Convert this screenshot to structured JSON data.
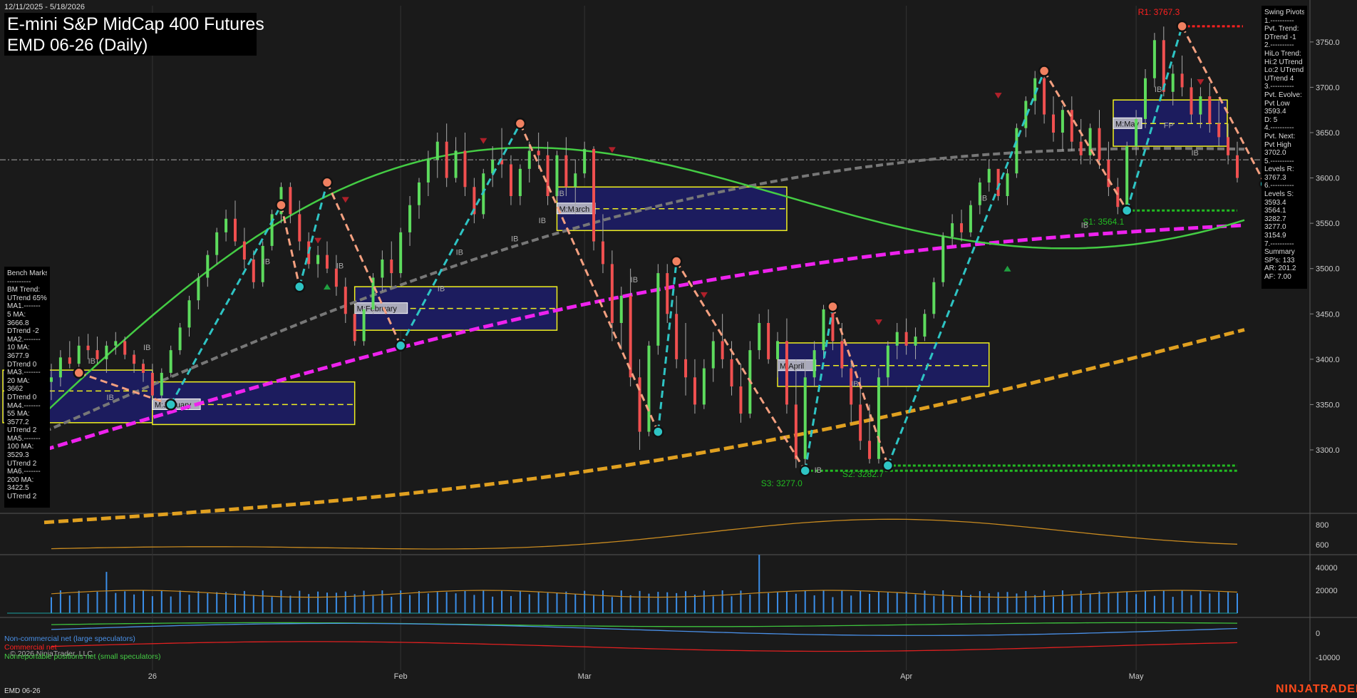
{
  "header": {
    "date_range": "12/11/2025 - 5/18/2026",
    "title_line1": "E-mini S&P MidCap 400 Futures",
    "title_line2": "EMD 06-26 (Daily)"
  },
  "footer": {
    "symbol": "EMD 06-26",
    "brand": "NINJATRADER",
    "copyright": "© 2026 NinjaTrader, LLC"
  },
  "legend": {
    "noncommercial": "Non-commercial net (large speculators)",
    "commercial": "Commercial net",
    "small": "Nonreportable positions net (small speculators)"
  },
  "swing_pivots": [
    "Swing Pivots",
    "1.----------",
    "Pvt. Trend:",
    "DTrend -1",
    "2.----------",
    "HiLo Trend:",
    "Hi:2 UTrend",
    "Lo:2 UTrend",
    "UTrend 4",
    "3.----------",
    "Pvt. Evolve:",
    "Pvt Low",
    "3593.4",
    "D: 5",
    "4.----------",
    "Pvt. Next:",
    "Pvt High",
    "3702.0",
    "5.----------",
    "Levels R:",
    "3767.3",
    "6.----------",
    "Levels S:",
    "3593.4",
    "3564.1",
    "3282.7",
    "3277.0",
    "3154.9",
    "7.----------",
    "Summary",
    "SP's: 133",
    "AR: 201.2",
    "AF: 7.00"
  ],
  "bench_marks": [
    "Bench Marks",
    "----------",
    "BM Trend:",
    "UTrend 65%",
    "MA1.-------",
    "5 MA:",
    "3666.8",
    "DTrend -2",
    "MA2.-------",
    "10 MA:",
    "3677.9",
    "DTrend 0",
    "MA3.-------",
    "20 MA:",
    "3662",
    "DTrend 0",
    "MA4.-------",
    "55 MA:",
    "3577.2",
    "UTrend 2",
    "MA5.-------",
    "100 MA:",
    "3529.3",
    "UTrend 2",
    "MA6.-------",
    "200 MA:",
    "3422.5",
    "UTrend 2"
  ],
  "colors": {
    "background": "#1a1a1a",
    "up_candle": "#5ddb5d",
    "down_candle": "#f05050",
    "swing_up": "#2ec4c4",
    "swing_down": "#f4a080",
    "ma_green": "#44cc44",
    "ma_gray": "#777777",
    "ma_magenta": "#ee22ee",
    "ma_orange": "#e0a020",
    "box_fill": "#1c1c5e",
    "box_border": "#f0f020",
    "resistance": "#ff2020",
    "support": "#22bb22"
  },
  "chart_data": {
    "type": "candlestick",
    "price_axis": {
      "ticks": [
        3300,
        3350,
        3400,
        3450,
        3500,
        3550,
        3600,
        3650,
        3700,
        3750
      ],
      "range": [
        3230,
        3790
      ]
    },
    "x_ticks": [
      "26",
      "Feb",
      "Mar",
      "Apr",
      "May"
    ],
    "ohlc": [
      [
        3375,
        3395,
        3355,
        3380
      ],
      [
        3380,
        3410,
        3370,
        3402
      ],
      [
        3402,
        3420,
        3390,
        3395
      ],
      [
        3395,
        3425,
        3385,
        3415
      ],
      [
        3415,
        3428,
        3400,
        3410
      ],
      [
        3410,
        3425,
        3395,
        3400
      ],
      [
        3400,
        3420,
        3385,
        3415
      ],
      [
        3415,
        3430,
        3405,
        3420
      ],
      [
        3420,
        3425,
        3400,
        3405
      ],
      [
        3405,
        3410,
        3385,
        3395
      ],
      [
        3395,
        3400,
        3375,
        3385
      ],
      [
        3385,
        3395,
        3355,
        3360
      ],
      [
        3360,
        3390,
        3345,
        3385
      ],
      [
        3385,
        3415,
        3380,
        3410
      ],
      [
        3410,
        3440,
        3405,
        3435
      ],
      [
        3435,
        3470,
        3425,
        3465
      ],
      [
        3465,
        3495,
        3455,
        3490
      ],
      [
        3490,
        3520,
        3480,
        3515
      ],
      [
        3515,
        3545,
        3505,
        3540
      ],
      [
        3540,
        3565,
        3530,
        3555
      ],
      [
        3555,
        3575,
        3525,
        3530
      ],
      [
        3530,
        3545,
        3500,
        3510
      ],
      [
        3510,
        3520,
        3478,
        3485
      ],
      [
        3485,
        3530,
        3480,
        3525
      ],
      [
        3525,
        3565,
        3520,
        3560
      ],
      [
        3560,
        3595,
        3550,
        3590
      ],
      [
        3590,
        3595,
        3550,
        3560
      ],
      [
        3560,
        3575,
        3520,
        3530
      ],
      [
        3530,
        3540,
        3500,
        3505
      ],
      [
        3505,
        3525,
        3490,
        3515
      ],
      [
        3515,
        3530,
        3495,
        3500
      ],
      [
        3500,
        3515,
        3470,
        3480
      ],
      [
        3480,
        3490,
        3440,
        3450
      ],
      [
        3450,
        3460,
        3415,
        3420
      ],
      [
        3420,
        3460,
        3415,
        3455
      ],
      [
        3455,
        3495,
        3450,
        3490
      ],
      [
        3490,
        3520,
        3475,
        3510
      ],
      [
        3510,
        3530,
        3480,
        3495
      ],
      [
        3495,
        3545,
        3490,
        3540
      ],
      [
        3540,
        3580,
        3525,
        3570
      ],
      [
        3570,
        3600,
        3555,
        3595
      ],
      [
        3595,
        3630,
        3580,
        3620
      ],
      [
        3620,
        3650,
        3600,
        3640
      ],
      [
        3640,
        3660,
        3590,
        3600
      ],
      [
        3600,
        3645,
        3595,
        3630
      ],
      [
        3630,
        3650,
        3580,
        3590
      ],
      [
        3590,
        3600,
        3550,
        3560
      ],
      [
        3560,
        3610,
        3555,
        3605
      ],
      [
        3605,
        3635,
        3590,
        3620
      ],
      [
        3620,
        3655,
        3600,
        3615
      ],
      [
        3615,
        3625,
        3570,
        3580
      ],
      [
        3580,
        3615,
        3570,
        3610
      ],
      [
        3610,
        3640,
        3595,
        3630
      ],
      [
        3630,
        3650,
        3610,
        3625
      ],
      [
        3625,
        3640,
        3570,
        3580
      ],
      [
        3580,
        3630,
        3575,
        3625
      ],
      [
        3625,
        3645,
        3580,
        3590
      ],
      [
        3590,
        3620,
        3560,
        3605
      ],
      [
        3605,
        3640,
        3600,
        3632
      ],
      [
        3632,
        3635,
        3520,
        3530
      ],
      [
        3530,
        3560,
        3495,
        3505
      ],
      [
        3505,
        3520,
        3420,
        3440
      ],
      [
        3440,
        3480,
        3410,
        3470
      ],
      [
        3470,
        3500,
        3370,
        3380
      ],
      [
        3380,
        3400,
        3300,
        3320
      ],
      [
        3320,
        3420,
        3315,
        3415
      ],
      [
        3415,
        3505,
        3405,
        3495
      ],
      [
        3495,
        3505,
        3440,
        3450
      ],
      [
        3450,
        3470,
        3390,
        3400
      ],
      [
        3400,
        3440,
        3360,
        3380
      ],
      [
        3380,
        3400,
        3340,
        3350
      ],
      [
        3350,
        3400,
        3345,
        3390
      ],
      [
        3390,
        3430,
        3375,
        3420
      ],
      [
        3420,
        3450,
        3390,
        3400
      ],
      [
        3400,
        3420,
        3360,
        3370
      ],
      [
        3370,
        3395,
        3330,
        3340
      ],
      [
        3340,
        3420,
        3335,
        3410
      ],
      [
        3410,
        3450,
        3400,
        3440
      ],
      [
        3440,
        3455,
        3395,
        3400
      ],
      [
        3400,
        3430,
        3380,
        3420
      ],
      [
        3420,
        3445,
        3340,
        3350
      ],
      [
        3350,
        3400,
        3280,
        3290
      ],
      [
        3290,
        3400,
        3280,
        3380
      ],
      [
        3380,
        3420,
        3370,
        3410
      ],
      [
        3410,
        3460,
        3400,
        3455
      ],
      [
        3455,
        3460,
        3410,
        3420
      ],
      [
        3420,
        3440,
        3380,
        3390
      ],
      [
        3390,
        3400,
        3330,
        3350
      ],
      [
        3350,
        3380,
        3300,
        3310
      ],
      [
        3310,
        3350,
        3285,
        3290
      ],
      [
        3290,
        3390,
        3285,
        3380
      ],
      [
        3380,
        3420,
        3370,
        3415
      ],
      [
        3415,
        3440,
        3400,
        3430
      ],
      [
        3430,
        3445,
        3405,
        3415
      ],
      [
        3415,
        3435,
        3400,
        3425
      ],
      [
        3425,
        3455,
        3420,
        3450
      ],
      [
        3450,
        3490,
        3445,
        3485
      ],
      [
        3485,
        3540,
        3480,
        3535
      ],
      [
        3535,
        3560,
        3525,
        3550
      ],
      [
        3550,
        3565,
        3530,
        3540
      ],
      [
        3540,
        3575,
        3535,
        3570
      ],
      [
        3570,
        3600,
        3560,
        3595
      ],
      [
        3595,
        3620,
        3585,
        3610
      ],
      [
        3610,
        3605,
        3575,
        3580
      ],
      [
        3580,
        3610,
        3570,
        3605
      ],
      [
        3605,
        3660,
        3600,
        3655
      ],
      [
        3655,
        3690,
        3645,
        3685
      ],
      [
        3685,
        3718,
        3670,
        3710
      ],
      [
        3710,
        3715,
        3660,
        3670
      ],
      [
        3670,
        3690,
        3640,
        3650
      ],
      [
        3650,
        3680,
        3630,
        3675
      ],
      [
        3675,
        3690,
        3630,
        3640
      ],
      [
        3640,
        3665,
        3615,
        3625
      ],
      [
        3625,
        3660,
        3615,
        3655
      ],
      [
        3655,
        3675,
        3610,
        3620
      ],
      [
        3620,
        3640,
        3580,
        3590
      ],
      [
        3590,
        3600,
        3560,
        3568
      ],
      [
        3568,
        3640,
        3565,
        3635
      ],
      [
        3635,
        3675,
        3625,
        3665
      ],
      [
        3665,
        3720,
        3655,
        3710
      ],
      [
        3710,
        3760,
        3700,
        3752
      ],
      [
        3752,
        3767,
        3690,
        3695
      ],
      [
        3695,
        3725,
        3680,
        3715
      ],
      [
        3715,
        3735,
        3690,
        3700
      ],
      [
        3700,
        3710,
        3660,
        3670
      ],
      [
        3670,
        3700,
        3655,
        3690
      ],
      [
        3690,
        3705,
        3650,
        3660
      ],
      [
        3660,
        3685,
        3635,
        3645
      ],
      [
        3645,
        3660,
        3615,
        3625
      ],
      [
        3625,
        3640,
        3595,
        3600
      ]
    ],
    "swing_points": [
      {
        "bar": 3,
        "price": 3385,
        "type": "high"
      },
      {
        "bar": 13,
        "price": 3350,
        "type": "low"
      },
      {
        "bar": 25,
        "price": 3570,
        "type": "high"
      },
      {
        "bar": 27,
        "price": 3480,
        "type": "low"
      },
      {
        "bar": 30,
        "price": 3595,
        "type": "high"
      },
      {
        "bar": 38,
        "price": 3415,
        "type": "low"
      },
      {
        "bar": 51,
        "price": 3660,
        "type": "high"
      },
      {
        "bar": 66,
        "price": 3320,
        "type": "low"
      },
      {
        "bar": 68,
        "price": 3508,
        "type": "high"
      },
      {
        "bar": 82,
        "price": 3277,
        "type": "low"
      },
      {
        "bar": 85,
        "price": 3458,
        "type": "high"
      },
      {
        "bar": 91,
        "price": 3282.7,
        "type": "low"
      },
      {
        "bar": 108,
        "price": 3718,
        "type": "high"
      },
      {
        "bar": 117,
        "price": 3564.1,
        "type": "low"
      },
      {
        "bar": 123,
        "price": 3767.3,
        "type": "high"
      },
      {
        "bar": 132,
        "price": 3593.4,
        "type": "low"
      }
    ],
    "moving_averages": [
      {
        "name": "20 MA",
        "color": "#44cc44",
        "start": 3340,
        "end": 3660
      },
      {
        "name": "55 MA",
        "color": "#777777",
        "start": 3320,
        "end": 3577.2
      },
      {
        "name": "100 MA",
        "color": "#ee22ee",
        "start": 3300,
        "end": 3529.3
      },
      {
        "name": "200 MA",
        "color": "#e0a020",
        "start": 3210,
        "end": 3422.5
      }
    ],
    "monthly_boxes": [
      {
        "label": "M:January",
        "high": 3375,
        "low": 3328,
        "mid": 3350
      },
      {
        "label": "M:February",
        "high": 3480,
        "low": 3432,
        "mid": 3456
      },
      {
        "label": "M:March",
        "high": 3590,
        "low": 3542,
        "mid": 3566
      },
      {
        "label": "M:April",
        "high": 3418,
        "low": 3370,
        "mid": 3393
      },
      {
        "label": "M:May",
        "high": 3686,
        "low": 3635,
        "mid": 3660
      }
    ],
    "levels": [
      {
        "label": "R1: 3767.3",
        "price": 3767.3,
        "kind": "resistance"
      },
      {
        "label": "S1: 3564.1",
        "price": 3564.1,
        "kind": "support"
      },
      {
        "label": "S2: 3282.7",
        "price": 3282.7,
        "kind": "support"
      },
      {
        "label": "S3: 3277.0",
        "price": 3277.0,
        "kind": "support"
      }
    ],
    "reference_price": 3620,
    "indicator_axis": {
      "ticks": [
        600,
        800
      ]
    },
    "volume_axis": {
      "ticks": [
        20000,
        40000
      ]
    },
    "cot_axis": {
      "ticks": [
        0,
        -10000
      ]
    },
    "ib_labels": [
      "IB",
      "IB",
      "IB",
      "IB",
      "IB",
      "IB",
      "IB",
      "IB",
      "IB",
      "IB",
      "IB",
      "IB",
      "IB",
      "IB",
      "IB",
      "IB",
      "IB",
      "FP"
    ]
  }
}
